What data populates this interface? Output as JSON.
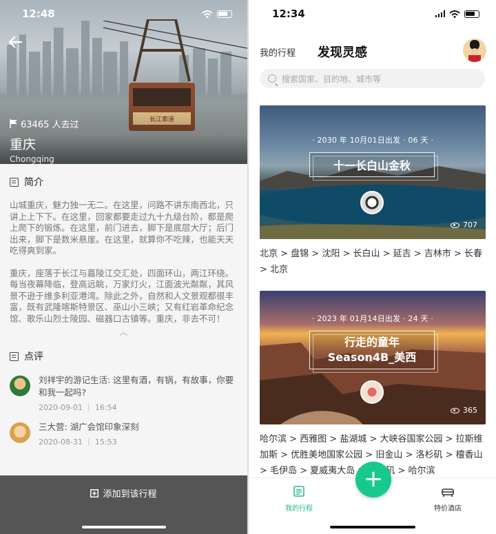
{
  "left": {
    "status_time": "12:48",
    "hero": {
      "visits": "63465 人去过",
      "city": "重庆",
      "city_en": "Chongqing"
    },
    "intro": {
      "title": "简介",
      "para1": "山城重庆，魅力独一无二。在这里，问路不讲东南西北，只讲上上下下。在这里，回家都要走过九十九级台阶，都是爬上爬下的锻炼。在这里，前门进去，脚下是底层大厅；后门出来，脚下是数米悬崖。在这里，就算你不吃辣，也能天天吃得爽到家。",
      "para2": "重庆，座落于长江与嘉陵江交汇处，四面环山，两江环绕。每当夜幕降临，登高远眺，万家灯火，江面波光粼粼，其风景不逊于维多利亚港湾。除此之外，自然和人文景观都很丰富，既有武隆喀斯特景区、巫山小三峡；又有红岩革命纪念馆、歌乐山烈士陵园、磁器口古镇等。重庆，非去不可！"
    },
    "reviews": {
      "title": "点评",
      "items": [
        {
          "text": "刘祥宇的游记生活: 这里有酒，有锅，有故事，你要和我一起吗?",
          "time": "2020-09-01 ｜ 16:54"
        },
        {
          "text": "三大营: 湖广会馆印象深刻",
          "time": "2020-08-31 ｜ 15:53"
        }
      ]
    },
    "add_button": "添加到该行程"
  },
  "right": {
    "status_time": "12:34",
    "nav": {
      "tab_my_trips": "我的行程",
      "tab_discover": "发现灵感"
    },
    "search_placeholder": "搜索国家、目的地、城市等",
    "cards": [
      {
        "date": "· 2030 年 10月01日出发 · 06 天 ·",
        "title_line1": "十一长白山金秋",
        "title_line2": "",
        "views": "707",
        "route": "北京 > 盘锦 > 沈阳 > 长白山 > 延吉 > 吉林市 > 长春 > 北京"
      },
      {
        "date": "· 2023 年 01月14日出发 · 24 天 ·",
        "title_line1": "行走的童年",
        "title_line2": "Season4B_美西",
        "views": "365",
        "route": "哈尔滨 > 西雅图 > 盐湖城 > 大峡谷国家公园 > 拉斯维加斯 > 优胜美地国家公园 > 旧金山 > 洛杉矶 > 檀香山 > 毛伊岛 > 夏威夷大岛 > 洛杉矶 > 哈尔滨"
      }
    ],
    "tabbar": {
      "trips": "我的行程",
      "hotels": "特价酒店",
      "fab": "+"
    }
  },
  "colors": {
    "accent": "#18c98d",
    "accent_text": "#2bbb85",
    "bottom_bar": "#555555"
  }
}
